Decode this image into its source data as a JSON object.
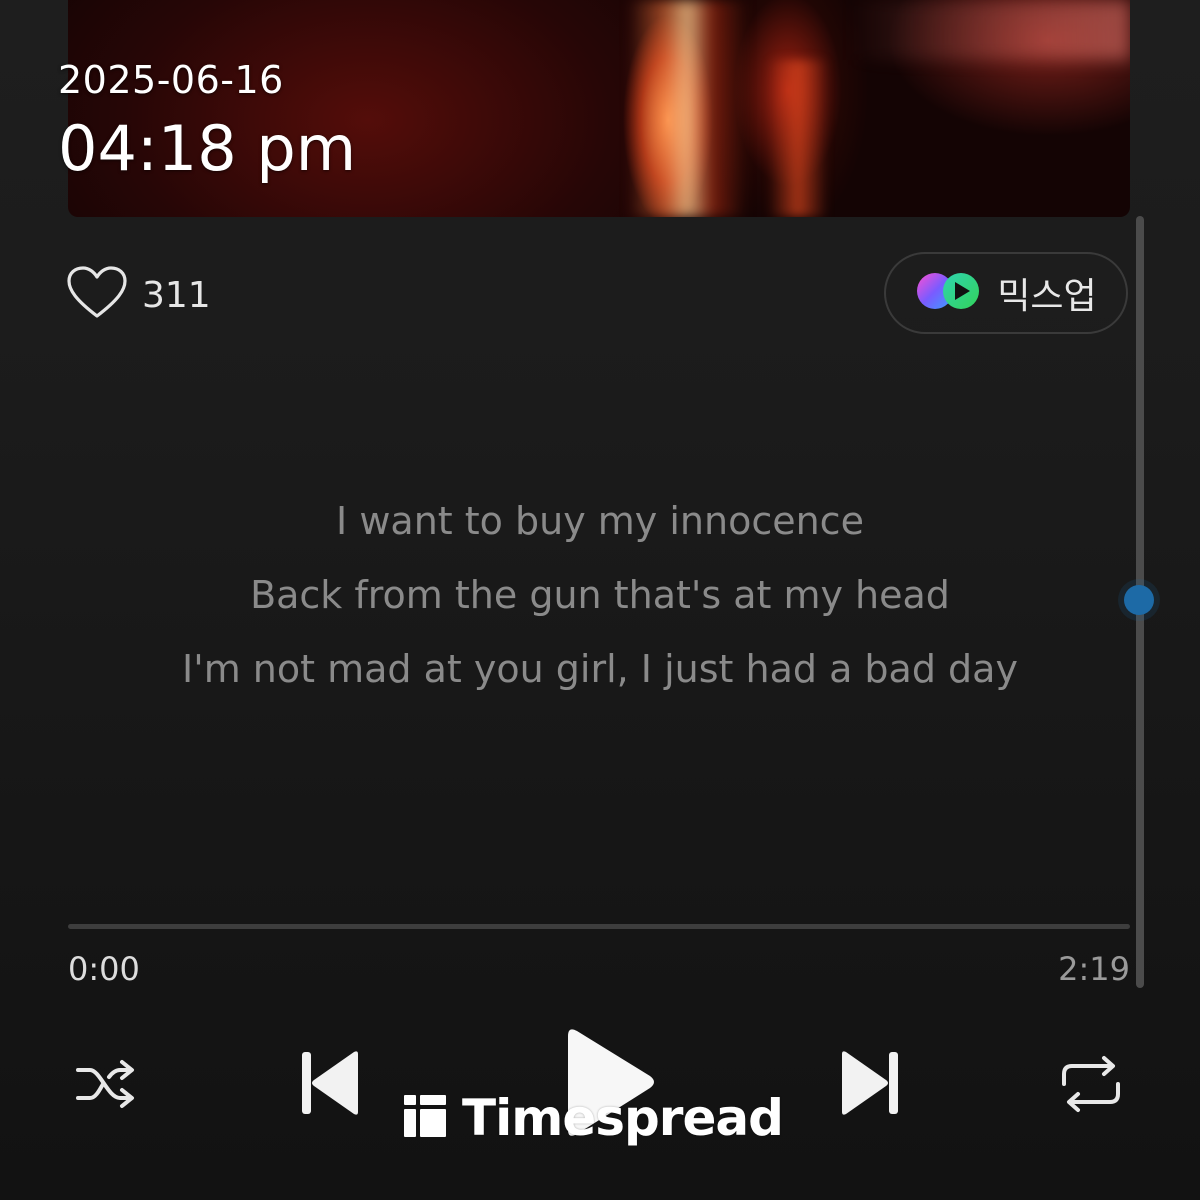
{
  "overlay": {
    "date": "2025-06-16",
    "time": "04:18 pm"
  },
  "like": {
    "icon": "heart-outline-icon",
    "count": "311"
  },
  "mixup": {
    "icon": "mixup-logo-icon",
    "label": "믹스업"
  },
  "lyrics": {
    "lines": [
      "I want to buy my innocence",
      "Back from the gun that's at my head",
      "I'm not mad at you girl, I just had a bad day"
    ]
  },
  "player": {
    "elapsed": "0:00",
    "total": "2:19",
    "progress": 0,
    "controls": {
      "shuffle": "shuffle-icon",
      "previous": "skip-previous-icon",
      "play": "play-icon",
      "next": "skip-next-icon",
      "repeat": "repeat-icon"
    }
  },
  "watermark": {
    "text": "Timespread"
  },
  "colors": {
    "background": "#1b1b1b",
    "lyric_text": "#8a8a8a",
    "scroll_thumb": "#1d6aa6",
    "mixup_gradient_start": "#a24bff",
    "mixup_gradient_end": "#2fd36a"
  }
}
